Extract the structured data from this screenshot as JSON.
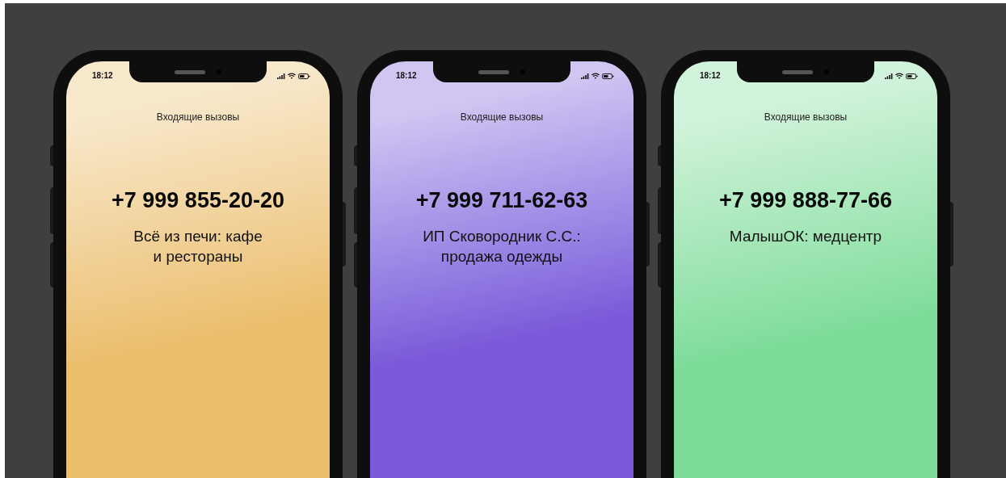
{
  "phones": [
    {
      "time": "18:12",
      "title": "Входящие вызовы",
      "number": "+7 999 855-20-20",
      "name_lines": [
        "Всё из печи: кафе",
        "и рестораны"
      ],
      "color": "#ebbe6c"
    },
    {
      "time": "18:12",
      "title": "Входящие вызовы",
      "number": "+7 999 711-62-63",
      "name_lines": [
        "ИП Сковородник С.С.:",
        "продажа одежды"
      ],
      "color": "#7b5ad9"
    },
    {
      "time": "18:12",
      "title": "Входящие вызовы",
      "number": "+7 999 888-77-66",
      "name_lines": [
        "МалышОК: медцентр"
      ],
      "color": "#7ddc9a"
    }
  ]
}
